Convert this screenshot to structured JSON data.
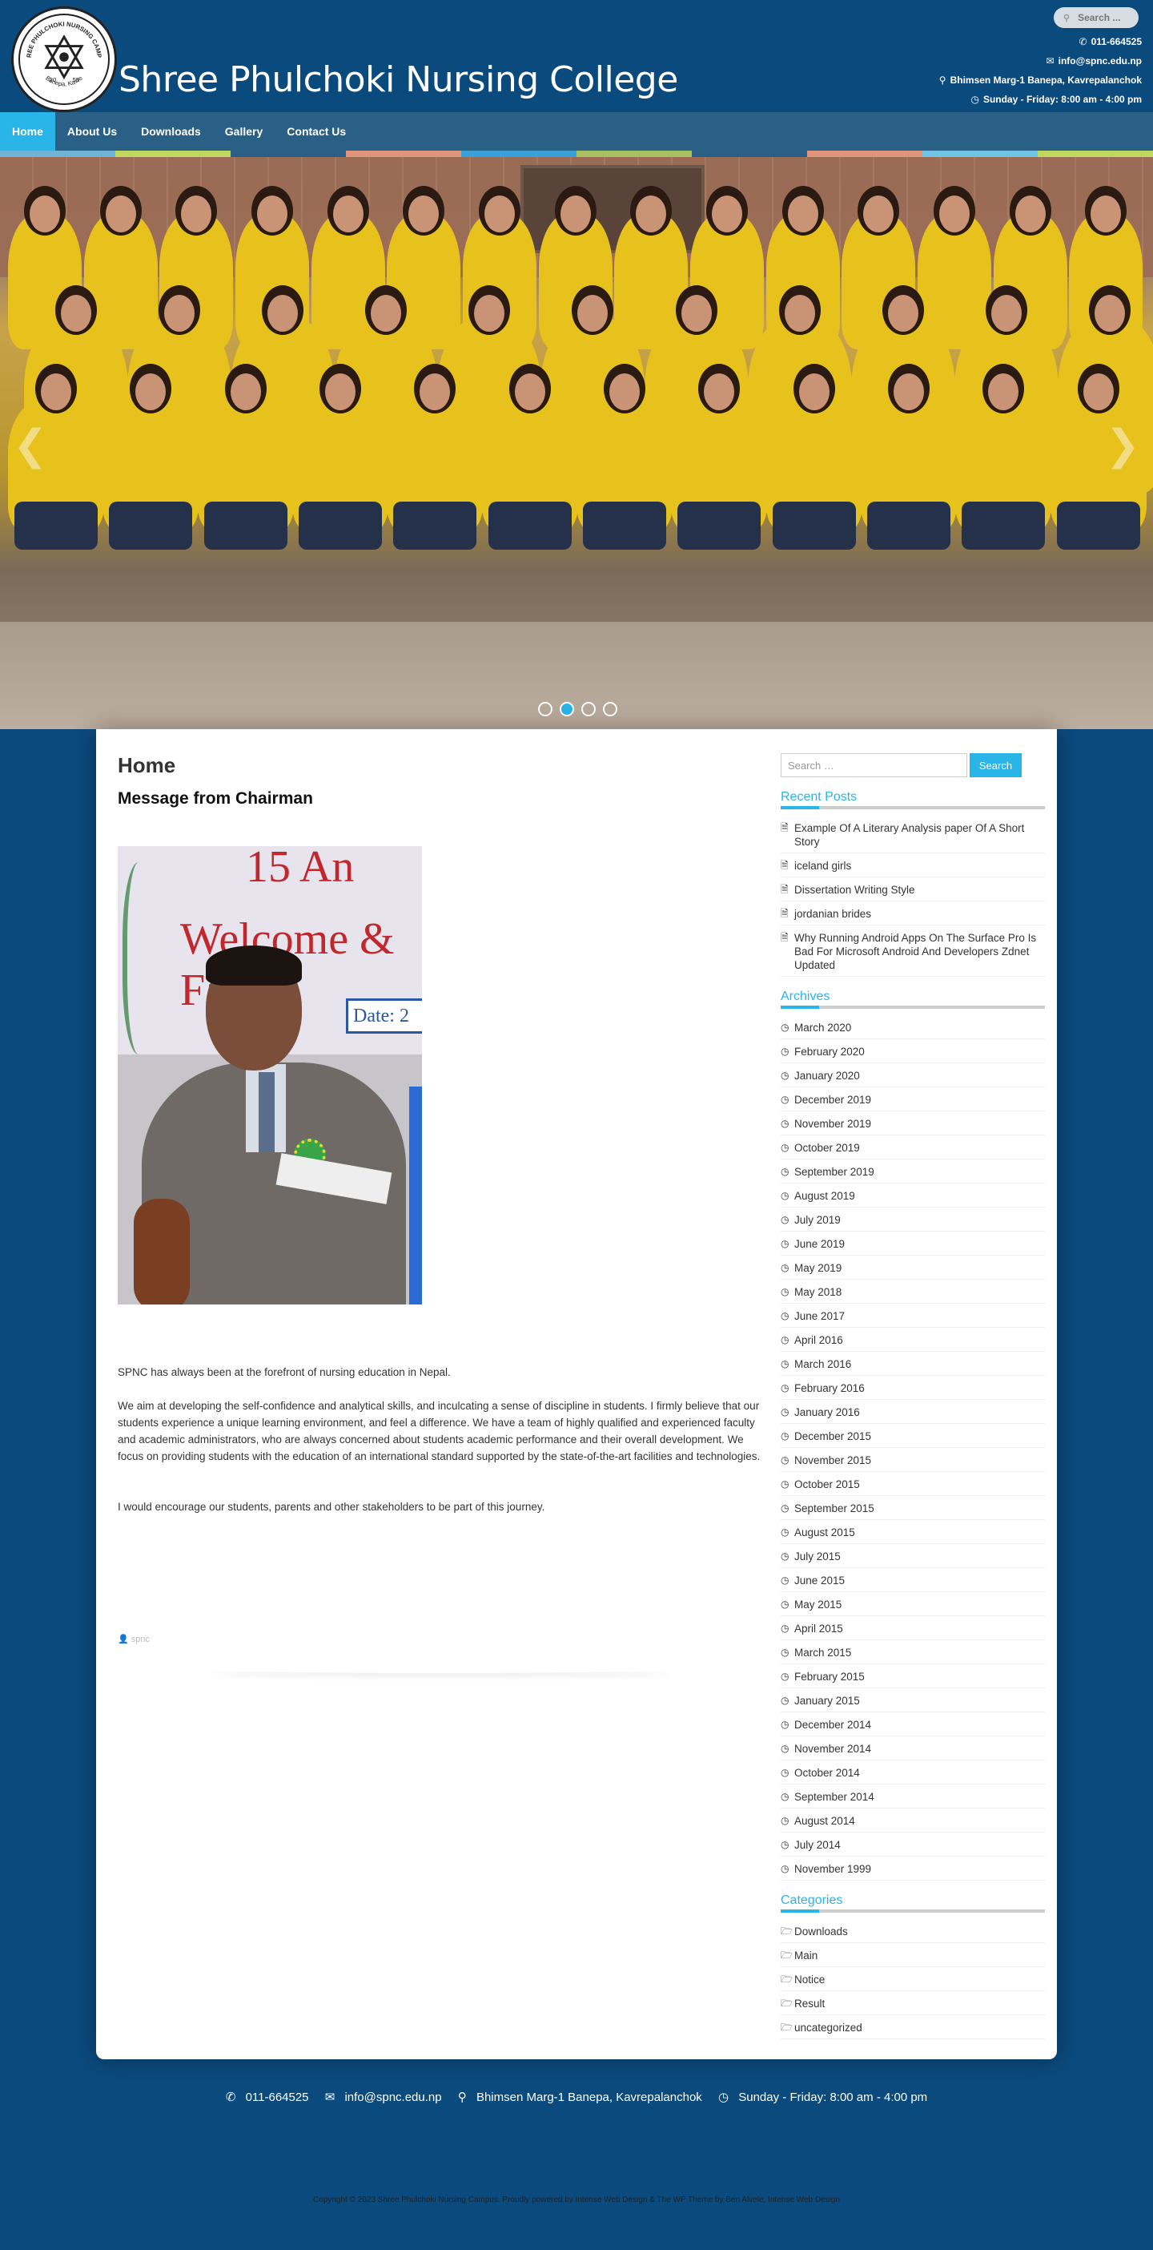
{
  "header": {
    "site_title": "Shree Phulchoki Nursing College",
    "logo_ring_text": "SHREE PHULCHOKI NURSING CAMPUS",
    "logo_ring_bottom": "Banepa, Kavre",
    "logo_year_left": "20",
    "logo_year_right": "55",
    "search_placeholder": "Search ...",
    "phone": "011-664525",
    "email": "info@spnc.edu.np",
    "address": "Bhimsen Marg-1 Banepa, Kavrepalanchok",
    "hours": "Sunday - Friday: 8:00 am - 4:00 pm"
  },
  "nav": {
    "items": [
      "Home",
      "About Us",
      "Downloads",
      "Gallery",
      "Contact Us"
    ],
    "active": "Home",
    "stripe_colors": [
      "#6fb3d8",
      "#c0d860",
      "#2a5f86",
      "#e0947c",
      "#3aa0d8",
      "#a8c060",
      "#2a5f86",
      "#e0947c",
      "#72c4e6",
      "#c0d860"
    ]
  },
  "slider": {
    "slide_count": 4,
    "active_slide": 2
  },
  "main": {
    "page_title": "Home",
    "post_title": "Message from Chairman",
    "image_text": {
      "banner_top": "15 An",
      "banner": "Welcome & Fa",
      "date": "Date: 2"
    },
    "paragraphs": [
      "SPNC has always been at the forefront of nursing education in Nepal.",
      "We aim at developing the self-confidence and analytical skills, and inculcating a sense of discipline in students. I firmly believe that our students experience a unique learning environment, and feel a difference. We have a team of highly qualified and experienced faculty and academic administrators, who are always concerned about students academic performance and their overall development. We focus on providing students with the education of an international standard supported by the state-of-the-art facilities and technologies.",
      "I would encourage our students, parents and other stakeholders to be part of this journey."
    ],
    "author": "spnc"
  },
  "sidebar": {
    "search_placeholder": "Search …",
    "search_button": "Search",
    "recent_posts_title": "Recent Posts",
    "recent_posts": [
      "Example Of A Literary Analysis paper Of A Short Story",
      "iceland girls",
      "Dissertation Writing Style",
      "jordanian brides",
      "Why Running Android Apps On The Surface Pro Is Bad For Microsoft Android And Developers Zdnet Updated"
    ],
    "archives_title": "Archives",
    "archives": [
      "March 2020",
      "February 2020",
      "January 2020",
      "December 2019",
      "November 2019",
      "October 2019",
      "September 2019",
      "August 2019",
      "July 2019",
      "June 2019",
      "May 2019",
      "May 2018",
      "June 2017",
      "April 2016",
      "March 2016",
      "February 2016",
      "January 2016",
      "December 2015",
      "November 2015",
      "October 2015",
      "September 2015",
      "August 2015",
      "July 2015",
      "June 2015",
      "May 2015",
      "April 2015",
      "March 2015",
      "February 2015",
      "January 2015",
      "December 2014",
      "November 2014",
      "October 2014",
      "September 2014",
      "August 2014",
      "July 2014",
      "November 1999"
    ],
    "categories_title": "Categories",
    "categories": [
      "Downloads",
      "Main",
      "Notice",
      "Result",
      "uncategorized"
    ]
  },
  "footer": {
    "phone": "011-664525",
    "email": "info@spnc.edu.np",
    "address": "Bhimsen Marg-1 Banepa, Kavrepalanchok",
    "hours": "Sunday - Friday: 8:00 am - 4:00 pm",
    "copyright": "Copyright © 2023 Shree Phulchoki Nursing Campus. Proudly powered by Intense Web Design & The WP Theme by Ben Alvele, Intense Web Design"
  },
  "colors": {
    "background": "#0b4a7d",
    "nav": "#2a5f86",
    "accent": "#29b5e8"
  },
  "icons": {
    "phone": "phone-icon",
    "email": "envelope-icon",
    "address": "map-marker-icon",
    "hours": "clock-icon",
    "post": "document-icon",
    "archive": "clock-icon",
    "category": "folder-open-icon",
    "author": "user-icon"
  }
}
